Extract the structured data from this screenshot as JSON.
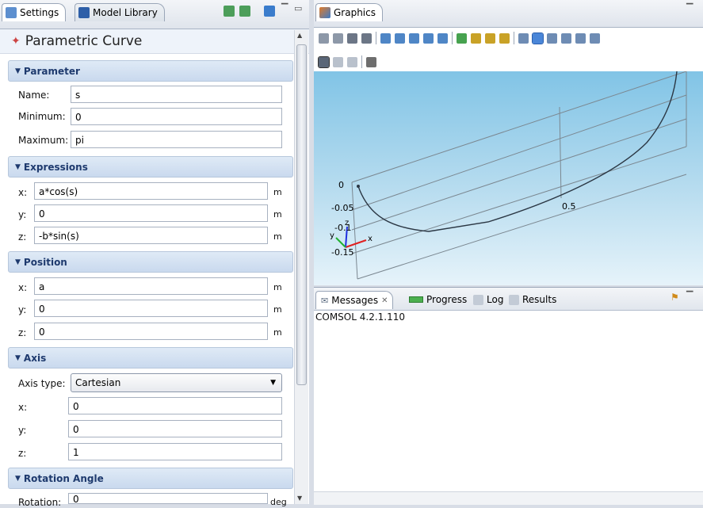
{
  "left_tabs": {
    "settings": "Settings",
    "model_library": "Model Library"
  },
  "panel_title": "Parametric Curve",
  "parameter": {
    "header": "Parameter",
    "name_label": "Name:",
    "name_value": "s",
    "min_label": "Minimum:",
    "min_value": "0",
    "max_label": "Maximum:",
    "max_value": "pi"
  },
  "expressions": {
    "header": "Expressions",
    "x_label": "x:",
    "x_value": "a*cos(s)",
    "x_unit": "m",
    "y_label": "y:",
    "y_value": "0",
    "y_unit": "m",
    "z_label": "z:",
    "z_value": "-b*sin(s)",
    "z_unit": "m"
  },
  "position": {
    "header": "Position",
    "x_label": "x:",
    "x_value": "a",
    "x_unit": "m",
    "y_label": "y:",
    "y_value": "0",
    "y_unit": "m",
    "z_label": "z:",
    "z_value": "0",
    "z_unit": "m"
  },
  "axis": {
    "header": "Axis",
    "type_label": "Axis type:",
    "type_value": "Cartesian",
    "x_label": "x:",
    "x_value": "0",
    "y_label": "y:",
    "y_value": "0",
    "z_label": "z:",
    "z_value": "1"
  },
  "rotation": {
    "header": "Rotation Angle",
    "label": "Rotation:",
    "value": "0",
    "unit": "deg"
  },
  "graphics": {
    "tab": "Graphics",
    "axis_labels": {
      "z0": "0",
      "zneg005": "-0.05",
      "zneg01": "-0.1",
      "zneg015": "-0.15",
      "x05": "0.5"
    },
    "triad": {
      "x": "x",
      "y": "y",
      "z": "z"
    }
  },
  "bottom_tabs": {
    "messages": "Messages",
    "progress": "Progress",
    "log": "Log",
    "results": "Results"
  },
  "messages_text": "COMSOL 4.2.1.110",
  "colors": {
    "accent": "#1e3a6e",
    "section_bg": "#d3e1f2",
    "sky_top": "#81c4e6",
    "sky_bottom": "#e6f3fa"
  }
}
